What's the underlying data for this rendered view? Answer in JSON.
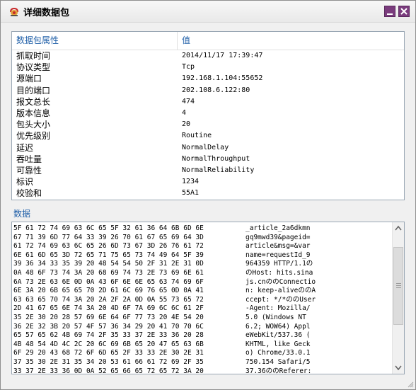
{
  "window": {
    "title": "详细数据包"
  },
  "props": {
    "header": {
      "name": "数据包属性",
      "value": "值"
    },
    "rows": [
      {
        "name": "抓取时间",
        "value": "2014/11/17 17:39:47"
      },
      {
        "name": "协议类型",
        "value": "Tcp"
      },
      {
        "name": "源端口",
        "value": "192.168.1.104:55652"
      },
      {
        "name": "目的端口",
        "value": "202.108.6.122:80"
      },
      {
        "name": "报文总长",
        "value": "474"
      },
      {
        "name": "版本信息",
        "value": "4"
      },
      {
        "name": "包头大小",
        "value": "20"
      },
      {
        "name": "优先级别",
        "value": "Routine"
      },
      {
        "name": "延迟",
        "value": "NormalDelay"
      },
      {
        "name": "吞吐量",
        "value": "NormalThroughput"
      },
      {
        "name": "可靠性",
        "value": "NormalReliability"
      },
      {
        "name": "标识",
        "value": "1234"
      },
      {
        "name": "校验和",
        "value": "55A1"
      }
    ]
  },
  "data_section": {
    "label": "数据",
    "hex": [
      "5F 61 72 74 69 63 6C 65 5F 32 61 36 64 6B 6D 6E",
      "67 71 39 6D 77 64 33 39 26 70 61 67 65 69 64 3D",
      "61 72 74 69 63 6C 65 26 6D 73 67 3D 26 76 61 72",
      "6E 61 6D 65 3D 72 65 71 75 65 73 74 49 64 5F 39",
      "39 36 34 33 35 39 20 48 54 54 50 2F 31 2E 31 0D",
      "0A 48 6F 73 74 3A 20 68 69 74 73 2E 73 69 6E 61",
      "6A 73 2E 63 6E 0D 0A 43 6F 6E 6E 65 63 74 69 6F",
      "6E 3A 20 6B 65 65 70 2D 61 6C 69 76 65 0D 0A 41",
      "63 63 65 70 74 3A 20 2A 2F 2A 0D 0A 55 73 65 72",
      "2D 41 67 65 6E 74 3A 20 4D 6F 7A 69 6C 6C 61 2F",
      "35 2E 30 20 28 57 69 6E 64 6F 77 73 20 4E 54 20",
      "36 2E 32 3B 20 57 4F 57 36 34 29 20 41 70 70 6C",
      "65 57 65 62 4B 69 74 2F 35 33 37 2E 33 36 20 28",
      "4B 48 54 4D 4C 2C 20 6C 69 6B 65 20 47 65 63 6B",
      "6F 29 20 43 68 72 6F 6D 65 2F 33 33 2E 30 2E 31",
      "37 35 30 2E 31 35 34 20 53 61 66 61 72 69 2F 35",
      "33 37 2E 33 36 0D 0A 52 65 66 65 72 65 72 3A 20"
    ],
    "ascii": [
      "_article_2a6dkmn",
      "gq9mwd39&pageid=",
      "article&msg=&var",
      "name=requestId_9",
      "964359 HTTP/1.1の",
      "のHost: hits.sina",
      "js.cnののConnectio",
      "n: keep-aliveののA",
      "ccept: */*ののUser",
      "-Agent: Mozilla/",
      "5.0 (Windows NT ",
      "6.2; WOW64) Appl",
      "eWebKit/537.36 (",
      "KHTML, like Geck",
      "o) Chrome/33.0.1",
      "750.154 Safari/5",
      "37.36ののReferer: "
    ]
  }
}
